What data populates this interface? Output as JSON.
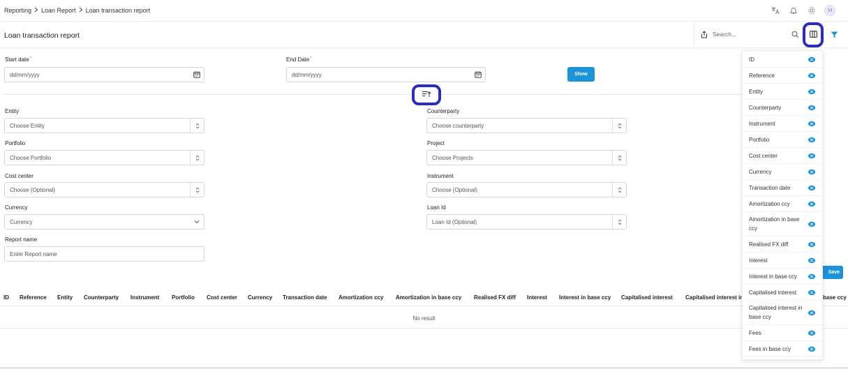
{
  "breadcrumb": {
    "items": [
      "Reporting",
      "Loan Report",
      "Loan transaction report"
    ]
  },
  "header": {
    "title": "Loan transaction report",
    "search_placeholder": "Search...",
    "user_initials": "VI"
  },
  "dates": {
    "start_label": "Start date",
    "start_placeholder": "dd/mm/yyyy",
    "end_label": "End Date",
    "end_placeholder": "dd/mm/yyyy",
    "show_label": "Show"
  },
  "filters": {
    "entity": {
      "label": "Entity",
      "placeholder": "Choose Entity"
    },
    "counterparty": {
      "label": "Counterparty",
      "placeholder": "Choose counterparty"
    },
    "portfolio": {
      "label": "Portfolio",
      "placeholder": "Choose Portfolio"
    },
    "project": {
      "label": "Project",
      "placeholder": "Choose Projects"
    },
    "cost_center": {
      "label": "Cost center",
      "placeholder": "Choose (Optional)"
    },
    "instrument": {
      "label": "Instrument",
      "placeholder": "Choose (Optional)"
    },
    "currency": {
      "label": "Currency",
      "placeholder": "Currency"
    },
    "loan_id": {
      "label": "Loan Id",
      "placeholder": "Loan Id (Optional)"
    },
    "report_name": {
      "label": "Report name",
      "placeholder": "Enter Report name"
    },
    "save_label": "Save"
  },
  "table": {
    "columns": [
      "ID",
      "Reference",
      "Entity",
      "Counterparty",
      "Instrument",
      "Portfolio",
      "Cost center",
      "Currency",
      "Transaction date",
      "Amortization ccy",
      "Amortization in base ccy",
      "Realised FX diff",
      "Interest",
      "Interest in base ccy",
      "Capitalised interest",
      "Capitalised interest in",
      "base ccy"
    ],
    "empty_text": "No result"
  },
  "column_panel": {
    "items": [
      "ID",
      "Reference",
      "Entity",
      "Counterparty",
      "Instrument",
      "Portfolio",
      "Cost center",
      "Currency",
      "Transaction date",
      "Amortization ccy",
      "Amortization in base ccy",
      "Realised FX diff",
      "Interest",
      "Interest in base ccy",
      "Capitalised interest",
      "Capitalised interest in base ccy",
      "Fees",
      "Fees in base ccy"
    ]
  },
  "colors": {
    "accent": "#1d93d8",
    "highlight": "#2c2cc0"
  }
}
